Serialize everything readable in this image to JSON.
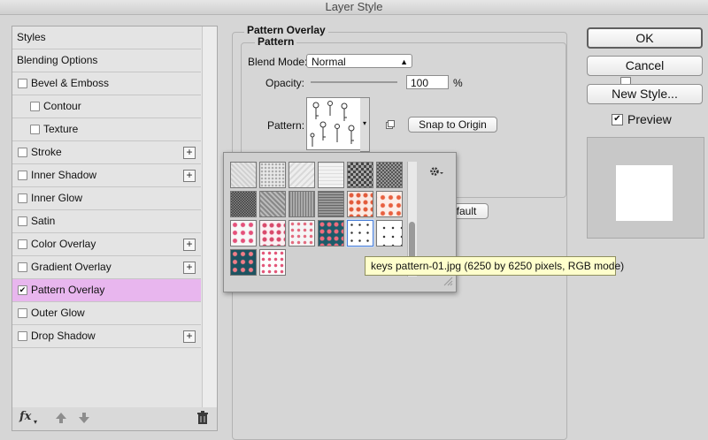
{
  "window": {
    "title": "Layer Style"
  },
  "sidebar": {
    "items": [
      {
        "label": "Styles",
        "checkbox": false,
        "plus": false,
        "indent": 0
      },
      {
        "label": "Blending Options",
        "checkbox": false,
        "plus": false,
        "indent": 0
      },
      {
        "label": "Bevel & Emboss",
        "checkbox": true,
        "checked": false,
        "plus": false,
        "indent": 0
      },
      {
        "label": "Contour",
        "checkbox": true,
        "checked": false,
        "plus": false,
        "indent": 1
      },
      {
        "label": "Texture",
        "checkbox": true,
        "checked": false,
        "plus": false,
        "indent": 1
      },
      {
        "label": "Stroke",
        "checkbox": true,
        "checked": false,
        "plus": true,
        "indent": 0
      },
      {
        "label": "Inner Shadow",
        "checkbox": true,
        "checked": false,
        "plus": true,
        "indent": 0
      },
      {
        "label": "Inner Glow",
        "checkbox": true,
        "checked": false,
        "plus": false,
        "indent": 0
      },
      {
        "label": "Satin",
        "checkbox": true,
        "checked": false,
        "plus": false,
        "indent": 0
      },
      {
        "label": "Color Overlay",
        "checkbox": true,
        "checked": false,
        "plus": true,
        "indent": 0
      },
      {
        "label": "Gradient Overlay",
        "checkbox": true,
        "checked": false,
        "plus": true,
        "indent": 0
      },
      {
        "label": "Pattern Overlay",
        "checkbox": true,
        "checked": true,
        "plus": false,
        "indent": 0,
        "selected": true
      },
      {
        "label": "Outer Glow",
        "checkbox": true,
        "checked": false,
        "plus": false,
        "indent": 0
      },
      {
        "label": "Drop Shadow",
        "checkbox": true,
        "checked": false,
        "plus": true,
        "indent": 0
      }
    ],
    "footer": {
      "fx_label": "fx",
      "icons": [
        "fx-icon",
        "move-up-icon",
        "move-down-icon",
        "trash-icon"
      ]
    }
  },
  "pattern_overlay": {
    "section_title": "Pattern Overlay",
    "group_title": "Pattern",
    "blend_mode_label": "Blend Mode:",
    "blend_mode_value": "Normal",
    "opacity_label": "Opacity:",
    "opacity_value": "100",
    "opacity_unit": "%",
    "opacity_level": 1.0,
    "pattern_label": "Pattern:",
    "snap_button": "Snap to Origin",
    "default_button_partial": "efault"
  },
  "pattern_picker": {
    "gear_icon": "gear-icon",
    "swatch_names": [
      "light-gray-noise",
      "gray-dots",
      "light-texture",
      "light-grid",
      "dark-check",
      "dark-check-2",
      "dark-noise",
      "gray-weave",
      "mid-gray-noise",
      "dark-gray-noise",
      "coral-florals",
      "coral-florals-2",
      "floral-pink",
      "floral-mixed",
      "floral-scatter",
      "teal-floral",
      "keys-pattern",
      "keys-pattern-2",
      "teal-floral-2",
      "pink-scatter"
    ],
    "selected_index": 16,
    "tooltip": "keys pattern-01.jpg (6250 by 6250 pixels, RGB mode)"
  },
  "right": {
    "ok": "OK",
    "cancel": "Cancel",
    "new_style": "New Style...",
    "preview_label": "Preview",
    "preview_checked": true
  },
  "colors": {
    "selected_item_bg": "#e8b6ee",
    "tooltip_bg": "#ffffcc",
    "panel_bg": "#d6d6d6"
  }
}
